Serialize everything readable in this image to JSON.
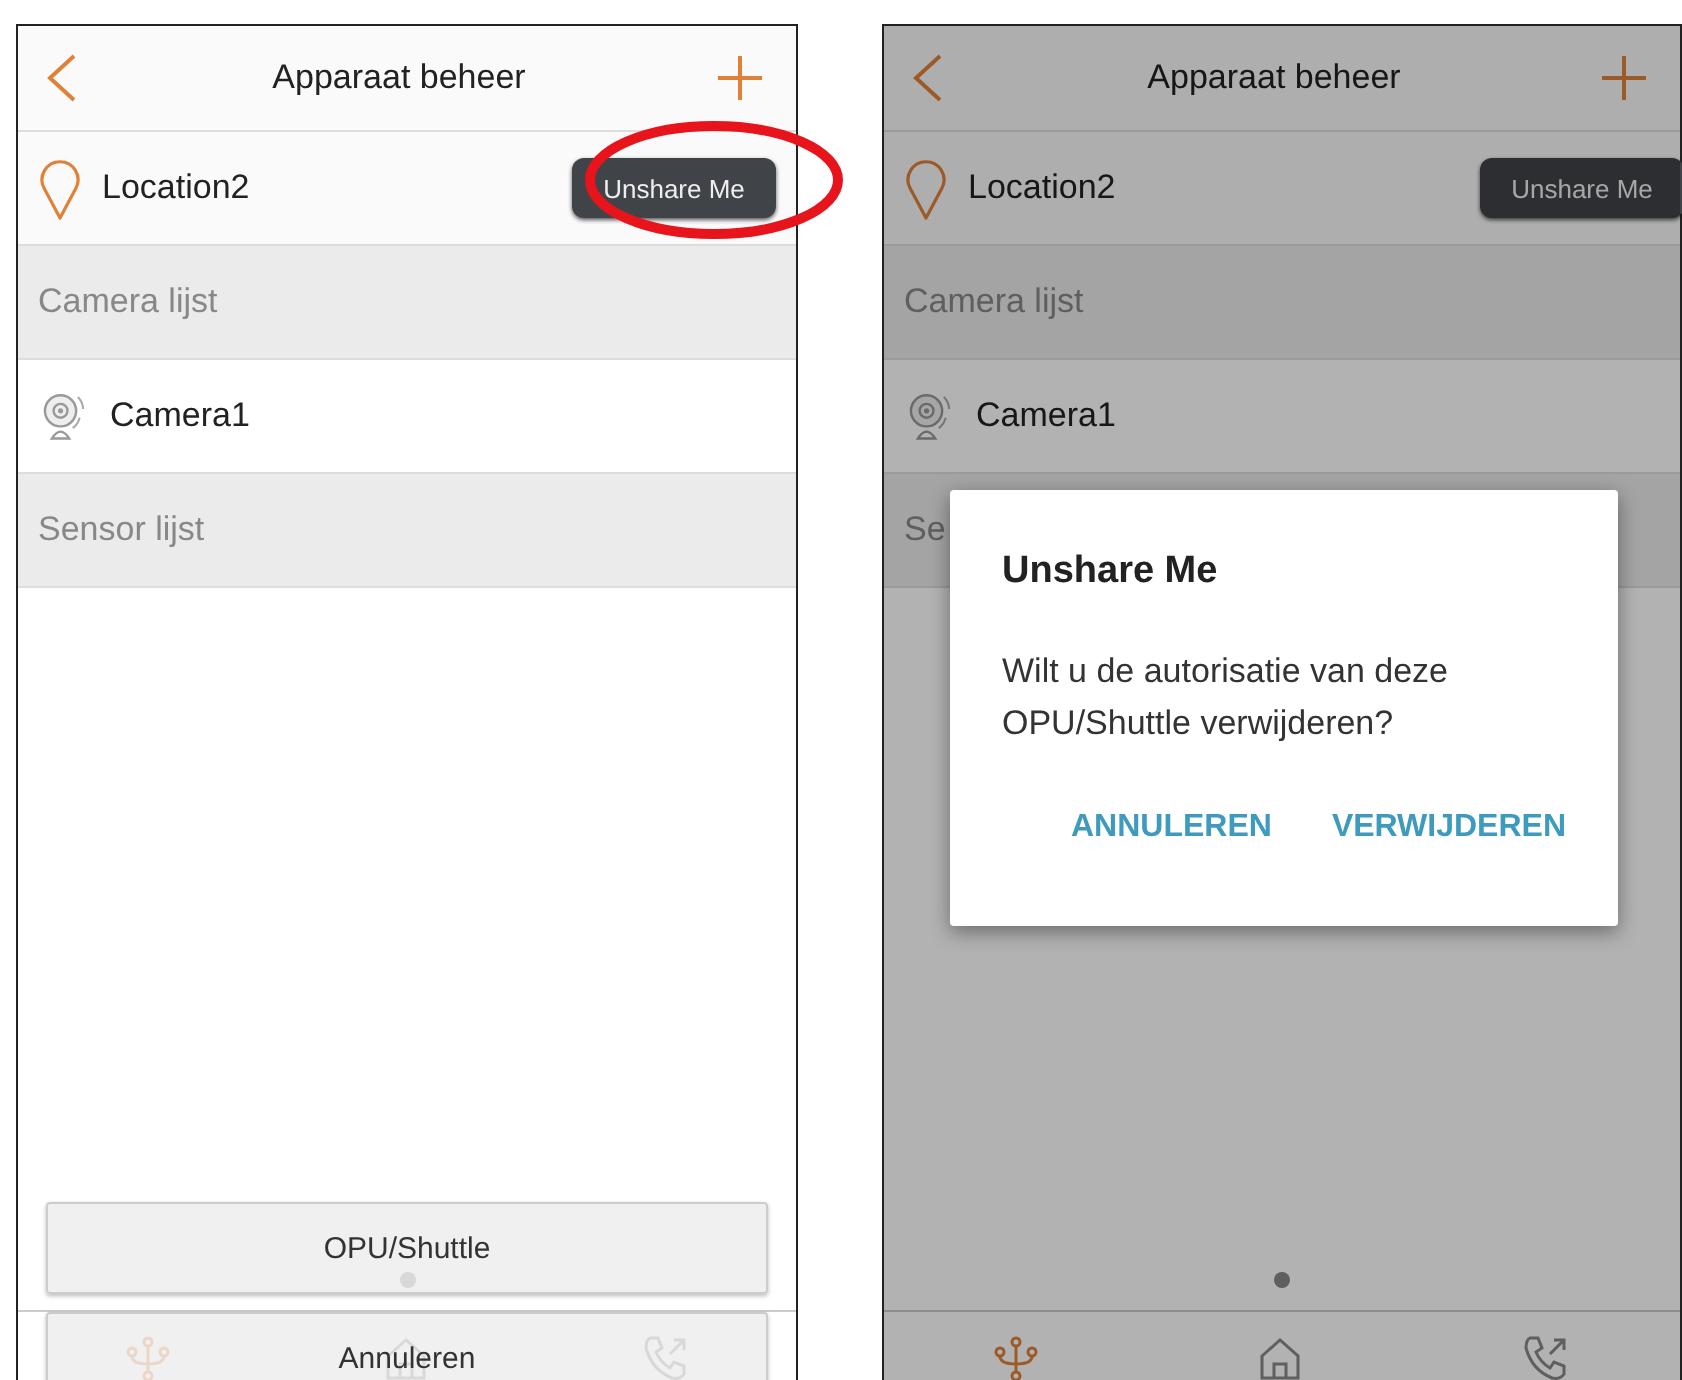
{
  "screens": [
    {
      "title": "Apparaat beheer",
      "rows": [
        {
          "kind": "location",
          "label": "Location2",
          "button": "Unshare Me",
          "circled": true
        },
        {
          "kind": "section",
          "label": "Camera lijst"
        },
        {
          "kind": "camera",
          "label": "Camera1"
        },
        {
          "kind": "section",
          "label": "Sensor lijst"
        }
      ],
      "nav_tabs": [
        {
          "selected": true
        },
        {
          "selected": false
        },
        {
          "selected": false
        }
      ],
      "action_sheet": {
        "buttons": [
          "OPU/Shuttle",
          "Annuleren"
        ]
      }
    },
    {
      "title": "Apparaat beheer",
      "dimmed": true,
      "rows": [
        {
          "kind": "location",
          "label": "Location2",
          "button": "Unshare Me"
        },
        {
          "kind": "section",
          "label": "Camera lijst"
        },
        {
          "kind": "camera",
          "label": "Camera1"
        },
        {
          "kind": "section",
          "label": "Se"
        }
      ],
      "nav_tabs": [
        {
          "selected": true
        },
        {
          "selected": false
        },
        {
          "selected": false
        }
      ],
      "dialog": {
        "title": "Unshare Me",
        "message": "Wilt u de autorisatie van deze OPU/Shuttle verwijderen?",
        "buttons": [
          "ANNULEREN",
          "VERWIJDEREN"
        ]
      }
    }
  ]
}
